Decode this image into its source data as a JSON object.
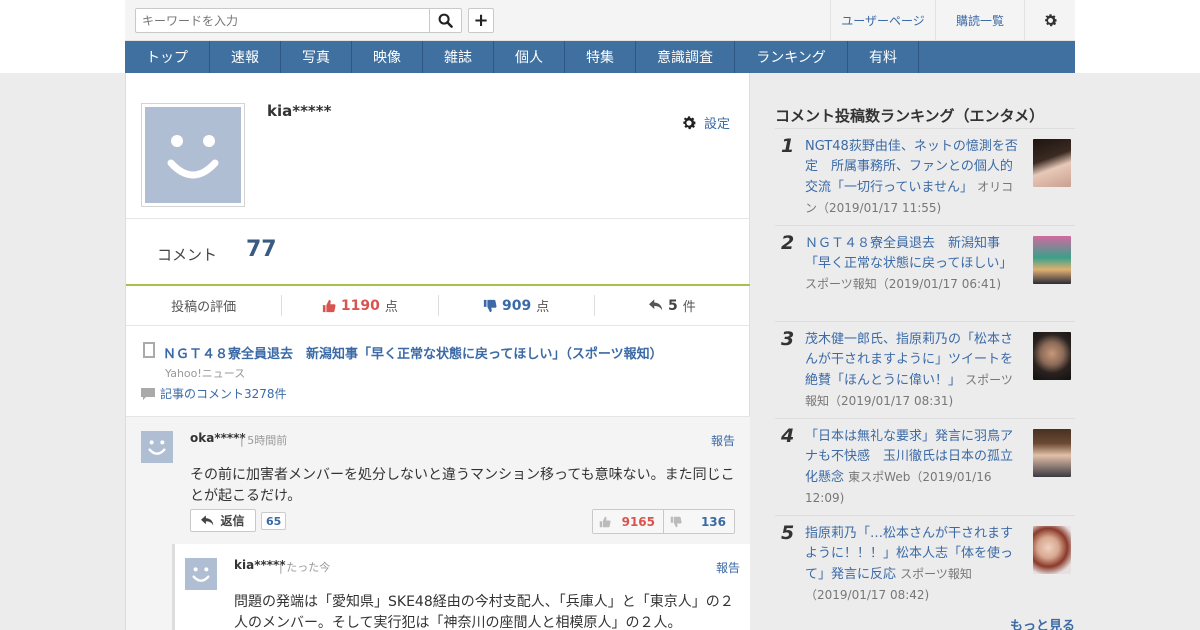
{
  "header": {
    "search_placeholder": "キーワードを入力",
    "add_label": "+",
    "user_page": "ユーザーページ",
    "subscriptions": "購読一覧"
  },
  "nav": {
    "items": [
      "トップ",
      "速報",
      "写真",
      "映像",
      "雑誌",
      "個人",
      "特集",
      "意識調査",
      "ランキング",
      "有料"
    ]
  },
  "profile": {
    "username": "kia*****",
    "settings_label": "設定"
  },
  "stats": {
    "comment_label": "コメント",
    "comment_count": "77",
    "rating_label": "投稿の評価",
    "good_count": "1190",
    "bad_count": "909",
    "reply_count": "5",
    "points_unit": "点",
    "replies_unit": "件"
  },
  "article": {
    "title": "ＮＧＴ４８寮全員退去　新潟知事「早く正常な状態に戻ってほしい」（スポーツ報知）",
    "source": "Yahoo!ニュース",
    "comments_link": "記事のコメント3278件"
  },
  "comment": {
    "user": "oka*****",
    "time": "5時間前",
    "report": "報告",
    "body": "その前に加害者メンバーを処分しないと違うマンション移っても意味ない。また同じことが起こるだけ。",
    "reply_label": "返信",
    "reply_count": "65",
    "good": "9165",
    "bad": "136"
  },
  "reply": {
    "user": "kia*****",
    "time": "たった今",
    "report": "報告",
    "body": "問題の発端は「愛知県」SKE48経由の今村支配人、「兵庫人」と「東京人」の２人のメンバー。そして実行犯は「神奈川の座間人と相模原人」の２人。"
  },
  "sidebar": {
    "title": "コメント投稿数ランキング（エンタメ）",
    "items": [
      {
        "rank": "1",
        "headline": "NGT48荻野由佳、ネットの憶測を否定　所属事務所、ファンとの個人的交流「一切行っていません」",
        "meta": "オリコン（2019/01/17 11:55)"
      },
      {
        "rank": "2",
        "headline": "ＮＧＴ４８寮全員退去　新潟知事「早く正常な状態に戻ってほしい」",
        "meta": "スポーツ報知（2019/01/17 06:41)"
      },
      {
        "rank": "3",
        "headline": "茂木健一郎氏、指原莉乃の「松本さんが干されますように」ツイートを絶賛「ほんとうに偉い！」",
        "meta": "スポーツ報知（2019/01/17 08:31)"
      },
      {
        "rank": "4",
        "headline": "「日本は無礼な要求」発言に羽鳥アナも不快感　玉川徹氏は日本の孤立化懸念",
        "meta": "東スポWeb（2019/01/16 12:09)"
      },
      {
        "rank": "5",
        "headline": "指原莉乃「…松本さんが干されますように！！！」松本人志「体を使って」発言に反応",
        "meta": "スポーツ報知（2019/01/17 08:42)"
      }
    ],
    "more": "もっと見る"
  },
  "colors": {
    "nav_bg": "#40709f",
    "link": "#3b6aa6",
    "good": "#d9534f",
    "accent_line": "#a6c24b",
    "avatar": "#b0bed4"
  }
}
